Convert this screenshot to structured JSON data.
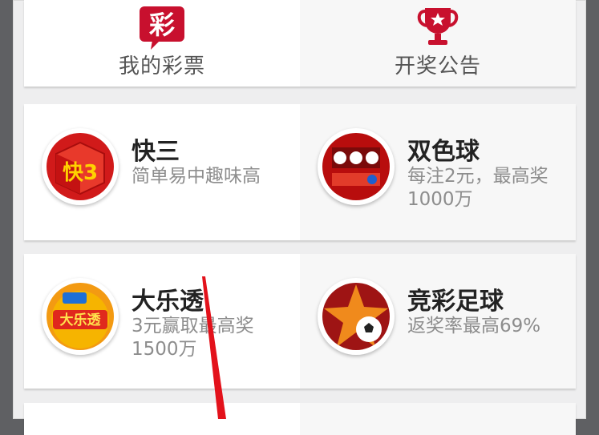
{
  "quick_entries": [
    {
      "label": "我的彩票",
      "icon": "lottery-ticket-icon",
      "icon_text": "彩"
    },
    {
      "label": "开奖公告",
      "icon": "trophy-icon"
    }
  ],
  "games": [
    {
      "name": "快三",
      "desc": "简单易中趣味高",
      "logo_icon": "kuaisan-dice-icon",
      "logo_text": "快3"
    },
    {
      "name": "双色球",
      "desc": "每注2元，最高奖1000万",
      "logo_icon": "shuangseqiu-icon"
    },
    {
      "name": "大乐透",
      "desc": "3元赢取最高奖1500万",
      "logo_icon": "daletou-icon",
      "logo_text": "大乐透"
    },
    {
      "name": "竞彩足球",
      "desc": "返奖率最高69%",
      "logo_icon": "football-icon"
    }
  ],
  "colors": {
    "accent": "#c8102e",
    "title": "#222222",
    "subtitle": "#8d8d8d",
    "background": "#eeeeef"
  }
}
